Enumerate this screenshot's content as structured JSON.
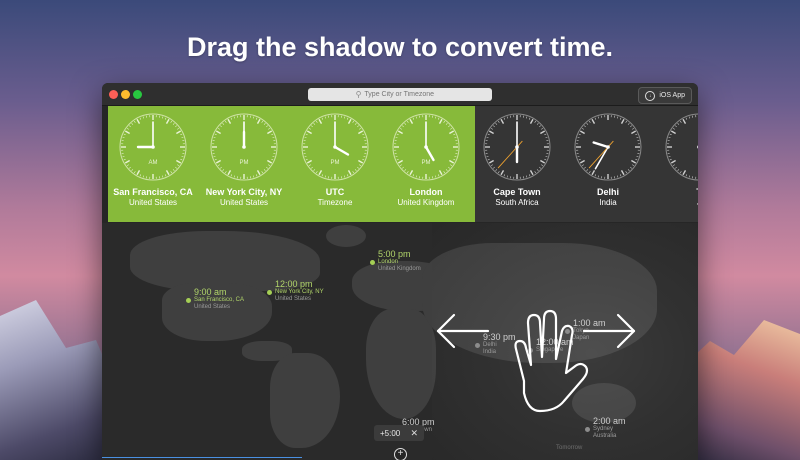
{
  "headline": "Drag the shadow to convert time.",
  "search": {
    "placeholder": "Type City or Timezone"
  },
  "ios_button": {
    "label": "iOS App"
  },
  "clocks": [
    {
      "city": "San Francisco, CA",
      "country": "United States",
      "ampm": "AM",
      "hour": 9,
      "minute": 0,
      "second": 0,
      "highlighted": true
    },
    {
      "city": "New York City, NY",
      "country": "United States",
      "ampm": "PM",
      "hour": 12,
      "minute": 0,
      "second": 0,
      "highlighted": true
    },
    {
      "city": "UTC",
      "country": "Timezone",
      "ampm": "PM",
      "hour": 4,
      "minute": 0,
      "second": 0,
      "highlighted": true
    },
    {
      "city": "London",
      "country": "United Kingdom",
      "ampm": "PM",
      "hour": 5,
      "minute": 0,
      "second": 0,
      "highlighted": true
    },
    {
      "city": "Cape Town",
      "country": "South Africa",
      "ampm": "",
      "hour": 6,
      "minute": 0,
      "second": 37,
      "highlighted": false
    },
    {
      "city": "Delhi",
      "country": "India",
      "ampm": "",
      "hour": 9,
      "minute": 35,
      "second": 37,
      "highlighted": false
    },
    {
      "city": "T",
      "country": "J",
      "ampm": "",
      "hour": 1,
      "minute": 0,
      "second": 0,
      "highlighted": false
    }
  ],
  "map_markers": [
    {
      "time": "9:00 am",
      "name": "San Francisco, CA",
      "country": "United States",
      "style": "green"
    },
    {
      "time": "12:00 pm",
      "name": "New York City, NY",
      "country": "United States",
      "style": "green"
    },
    {
      "time": "5:00 pm",
      "name": "London",
      "country": "United Kingdom",
      "style": "green"
    },
    {
      "time": "9:30 pm",
      "name": "Delhi",
      "country": "India",
      "style": "gray"
    },
    {
      "time": "12:00 am",
      "name": "Singapore",
      "country": "",
      "style": "gray"
    },
    {
      "time": "1:00 am",
      "name": "Tokyo",
      "country": "Japan",
      "style": "gray"
    },
    {
      "time": "6:00 pm",
      "name": "Cape Town",
      "country": "",
      "style": "gray"
    },
    {
      "time": "2:00 am",
      "name": "Sydney",
      "country": "Australia",
      "style": "gray"
    }
  ],
  "offset": {
    "label": "+5:00",
    "close": "✕"
  },
  "tomorrow_label": "Tomorrow",
  "add_button": "+",
  "colors": {
    "green_panel": "#87ba3a",
    "orange_hand": "#f0a330",
    "marker_green": "#a5cf55"
  }
}
